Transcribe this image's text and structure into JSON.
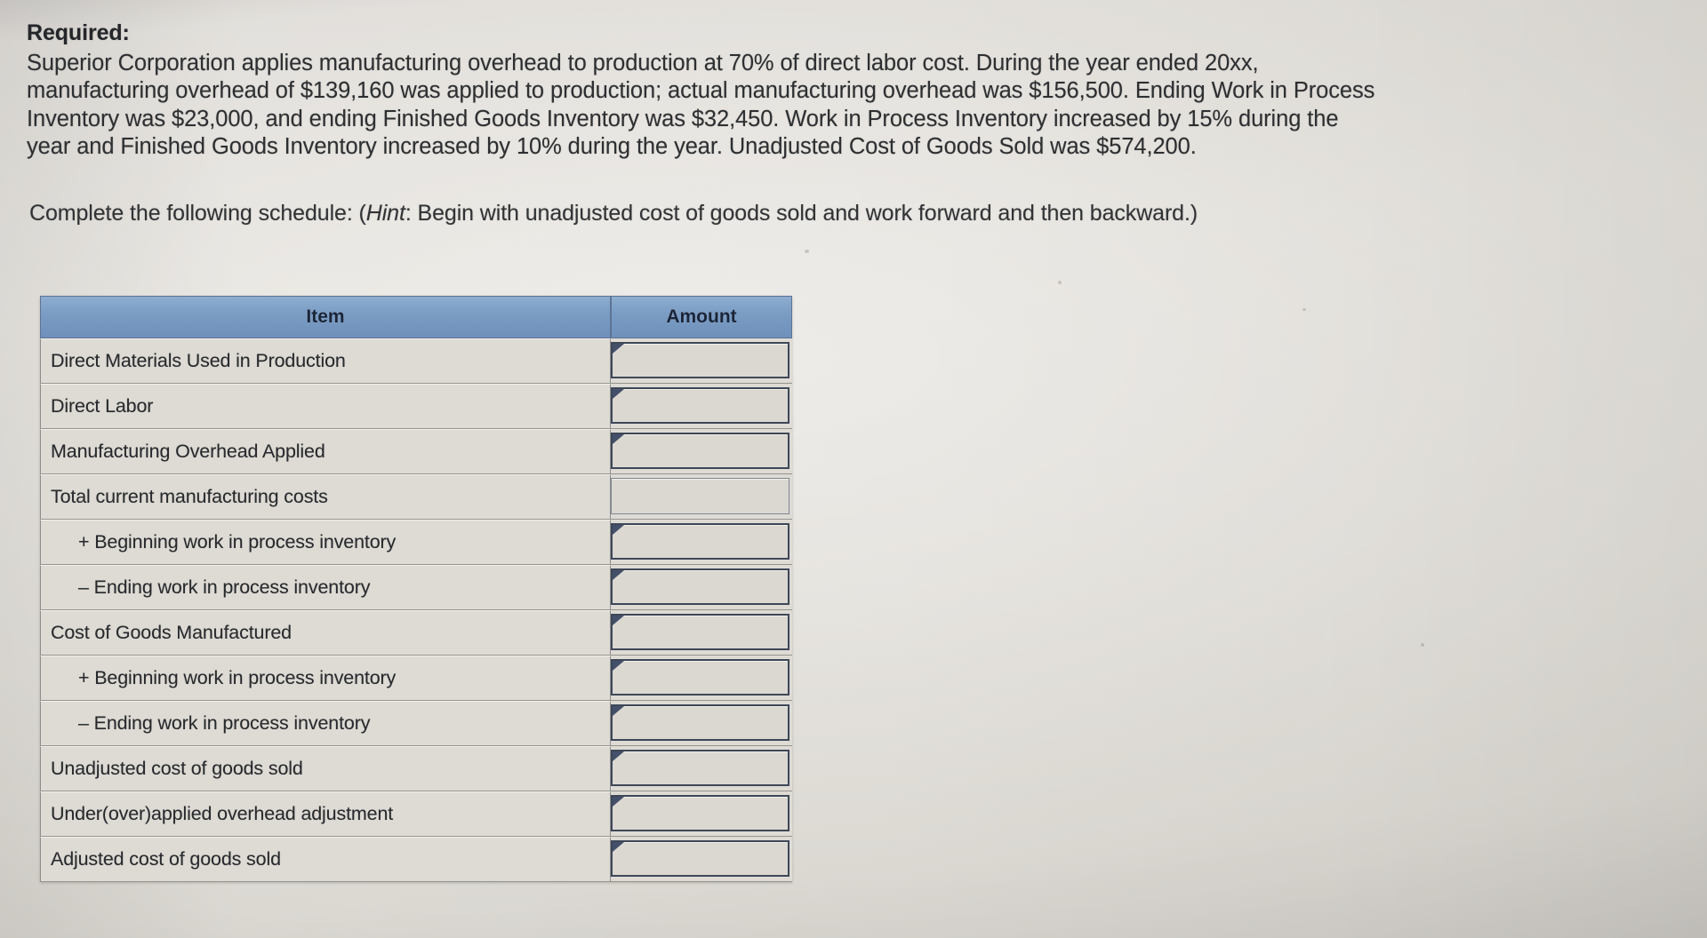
{
  "document": {
    "required_label": "Required:",
    "problem_text": "Superior Corporation applies manufacturing overhead to production at 70% of direct labor cost. During the year ended 20xx, manufacturing overhead of $139,160 was applied to production; actual manufacturing overhead was $156,500. Ending Work in Process Inventory was $23,000, and ending Finished Goods Inventory was $32,450. Work in Process Inventory increased by 15% during the year and Finished Goods Inventory increased by 10% during the year. Unadjusted Cost of Goods Sold was $574,200.",
    "instruction_prefix": "Complete the following schedule: (",
    "instruction_hint_word": "Hint",
    "instruction_suffix": ": Begin with unadjusted cost of goods sold and work forward and then backward.)",
    "facts": {
      "overhead_rate": "70%",
      "year": "20xx",
      "overhead_applied": "$139,160",
      "actual_overhead": "$156,500",
      "ending_wip": "$23,000",
      "ending_fg": "$32,450",
      "wip_increase": "15%",
      "fg_increase": "10%",
      "unadjusted_cogs": "$574,200"
    }
  },
  "table": {
    "headers": {
      "item": "Item",
      "amount": "Amount"
    },
    "rows": [
      {
        "label": "Direct Materials Used in Production",
        "indent": false,
        "amount": "",
        "input": true
      },
      {
        "label": "Direct Labor",
        "indent": false,
        "amount": "",
        "input": true
      },
      {
        "label": "Manufacturing Overhead Applied",
        "indent": false,
        "amount": "",
        "input": true
      },
      {
        "label": "Total current manufacturing costs",
        "indent": false,
        "amount": "",
        "input": false
      },
      {
        "label": "+ Beginning work in process inventory",
        "indent": true,
        "amount": "",
        "input": true
      },
      {
        "label": "– Ending work in process inventory",
        "indent": true,
        "amount": "",
        "input": true
      },
      {
        "label": "Cost of Goods Manufactured",
        "indent": false,
        "amount": "",
        "input": true
      },
      {
        "label": "+ Beginning work in process inventory",
        "indent": true,
        "amount": "",
        "input": true
      },
      {
        "label": "– Ending work in process inventory",
        "indent": true,
        "amount": "",
        "input": true
      },
      {
        "label": "Unadjusted cost of goods sold",
        "indent": false,
        "amount": "",
        "input": true
      },
      {
        "label": "Under(over)applied overhead adjustment",
        "indent": false,
        "amount": "",
        "input": true
      },
      {
        "label": "Adjusted cost of goods sold",
        "indent": false,
        "amount": "",
        "input": true
      }
    ]
  },
  "colors": {
    "header_blue": "#7b9dc4",
    "paper": "#dedbd5",
    "input_border": "#3e4757",
    "text": "#27292c"
  }
}
